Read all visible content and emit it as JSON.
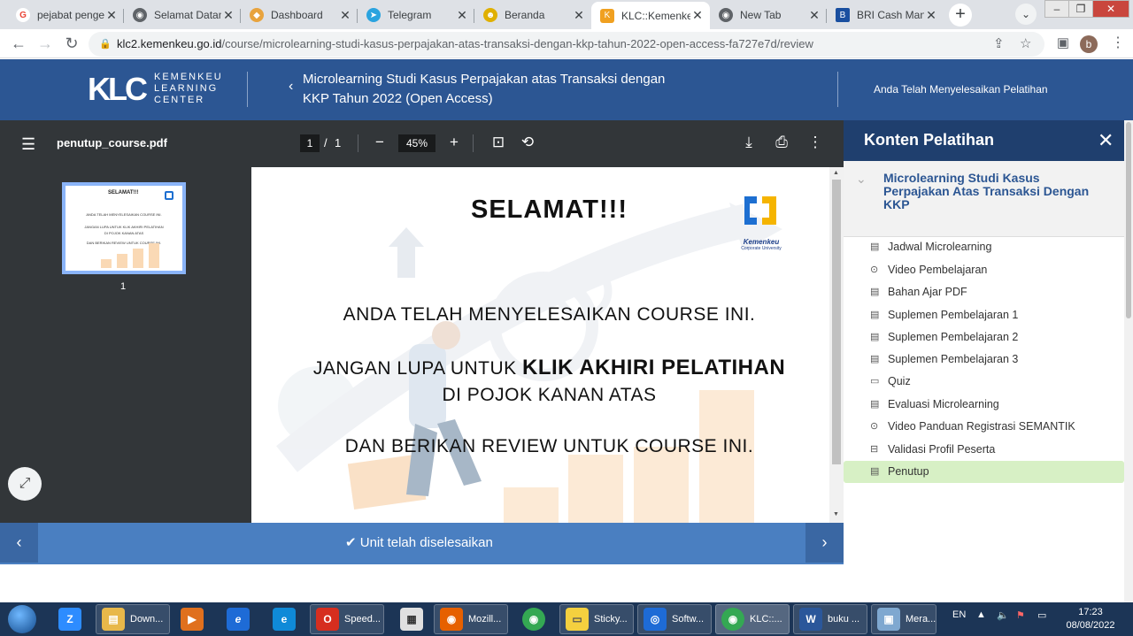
{
  "browser": {
    "tabs": [
      {
        "title": "pejabat penge",
        "color": "#ea4335",
        "glyph": "G"
      },
      {
        "title": "Selamat Datan",
        "color": "#5f6368",
        "glyph": "◉"
      },
      {
        "title": "Dashboard",
        "color": "#e8a33d",
        "glyph": "◆"
      },
      {
        "title": "Telegram",
        "color": "#2aa3df",
        "glyph": "➤"
      },
      {
        "title": "Beranda",
        "color": "#e0b000",
        "glyph": "☻"
      },
      {
        "title": "KLC::Kemenke",
        "color": "#f0a020",
        "glyph": "K"
      },
      {
        "title": "New Tab",
        "color": "#5f6368",
        "glyph": "◉"
      },
      {
        "title": "BRI Cash Man",
        "color": "#1a4fa0",
        "glyph": "B"
      }
    ],
    "url_host": "klc2.kemenkeu.go.id",
    "url_path": "/course/microlearning-studi-kasus-perpajakan-atas-transaksi-dengan-kkp-tahun-2022-open-access-fa727e7d/review",
    "profile_initial": "b"
  },
  "header": {
    "logo_mark": "KLC",
    "logo_line1": "KEMENKEU",
    "logo_line2": "LEARNING",
    "logo_line3": "CENTER",
    "course_title": "Microlearning Studi Kasus Perpajakan atas Transaksi dengan KKP Tahun 2022 (Open Access)",
    "done_label": "Anda Telah Menyelesaikan Pelatihan"
  },
  "pdf": {
    "filename": "penutup_course.pdf",
    "page_current": "1",
    "page_sep": "/",
    "page_total": "1",
    "zoom": "45%",
    "thumb_label": "1",
    "slide": {
      "title": "SELAMAT!!!",
      "line1": "ANDA TELAH MENYELESAIKAN COURSE INI.",
      "line2_pre": "JANGAN LUPA UNTUK ",
      "line2_bold": "KLIK AKHIRI PELATIHAN",
      "line3": "DI POJOK KANAN ATAS",
      "line4": "DAN BERIKAN REVIEW UNTUK COURSE INI.",
      "logo_caption": "Kemenkeu",
      "logo_caption2": "Corporate University"
    },
    "thumb_text": {
      "title": "SELAMAT!!!",
      "l1": "ANDA TELAH MENYELESAIKAN COURSE INI.",
      "l2": "JANGAN LUPA UNTUK KLIK AKHIRI PELATIHAN",
      "l3": "DI POJOK KANAN ATAS",
      "l4": "DAN BERIKAN REVIEW UNTUK COURSE INI."
    }
  },
  "unit_bar": {
    "message": "✔ Unit telah diselesaikan"
  },
  "sidebar": {
    "title": "Konten Pelatihan",
    "section_title": "Microlearning Studi Kasus Perpajakan Atas Transaksi Dengan KKP",
    "items": [
      {
        "label": "Jadwal Microlearning",
        "icon": "document-icon"
      },
      {
        "label": "Video Pembelajaran",
        "icon": "play-icon"
      },
      {
        "label": "Bahan Ajar PDF",
        "icon": "document-icon"
      },
      {
        "label": "Suplemen Pembelajaran 1",
        "icon": "document-icon"
      },
      {
        "label": "Suplemen Pembelajaran 2",
        "icon": "document-icon"
      },
      {
        "label": "Suplemen Pembelajaran 3",
        "icon": "document-icon"
      },
      {
        "label": "Quiz",
        "icon": "gamepad-icon"
      },
      {
        "label": "Evaluasi Microlearning",
        "icon": "document-icon"
      },
      {
        "label": "Video Panduan Registrasi SEMANTIK",
        "icon": "play-icon"
      },
      {
        "label": "Validasi Profil Peserta",
        "icon": "form-icon"
      },
      {
        "label": "Penutup",
        "icon": "document-icon"
      }
    ],
    "active_index": 10
  },
  "taskbar": {
    "items": [
      {
        "label": "",
        "color": "#2d8cff",
        "glyph": "Z"
      },
      {
        "label": "Down...",
        "color": "#e8b84a",
        "glyph": "▤"
      },
      {
        "label": "",
        "color": "#e0701e",
        "glyph": "▶"
      },
      {
        "label": "",
        "color": "#1e6bd6",
        "glyph": "e"
      },
      {
        "label": "",
        "color": "#0f8ad8",
        "glyph": "e"
      },
      {
        "label": "Speed...",
        "color": "#d62e1f",
        "glyph": "O"
      },
      {
        "label": "",
        "color": "#e0e0e0",
        "glyph": "▦"
      },
      {
        "label": "Mozill...",
        "color": "#e66000",
        "glyph": "◉"
      },
      {
        "label": "",
        "color": "#34a853",
        "glyph": "◉"
      },
      {
        "label": "Sticky...",
        "color": "#f4d03f",
        "glyph": "▭"
      },
      {
        "label": "Softw...",
        "color": "#1e6bd6",
        "glyph": "◎"
      },
      {
        "label": "KLC::...",
        "color": "#34a853",
        "glyph": "◉"
      },
      {
        "label": "buku ...",
        "color": "#2b579a",
        "glyph": "W"
      },
      {
        "label": "Mera...",
        "color": "#7fa8d0",
        "glyph": "▣"
      }
    ],
    "lang": "EN",
    "time": "17:23",
    "date": "08/08/2022"
  }
}
